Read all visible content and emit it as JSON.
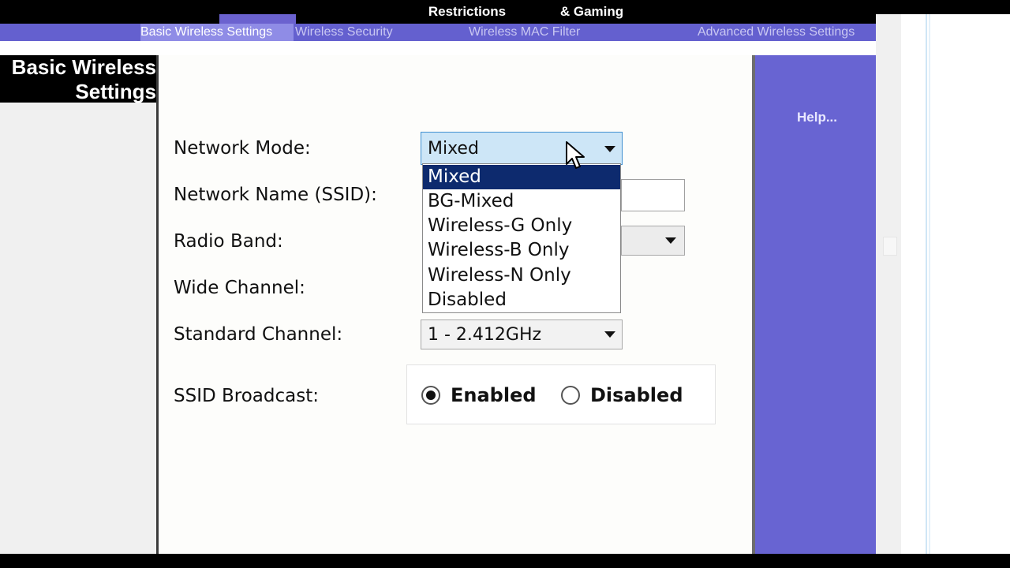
{
  "header": {
    "top_tabs": [
      "Restrictions",
      "& Gaming"
    ],
    "sub_tabs": [
      "Basic Wireless Settings",
      "Wireless Security",
      "Wireless MAC Filter",
      "Advanced Wireless Settings"
    ]
  },
  "section": {
    "title_line1": "Basic Wireless",
    "title_line2": "Settings"
  },
  "help": {
    "label": "Help..."
  },
  "form": {
    "network_mode_label": "Network Mode:",
    "network_mode_value": "Mixed",
    "network_mode_options": [
      "Mixed",
      "BG-Mixed",
      "Wireless-G Only",
      "Wireless-B Only",
      "Wireless-N Only",
      "Disabled"
    ],
    "ssid_label": "Network Name (SSID):",
    "radio_band_label": "Radio Band:",
    "wide_channel_label": "Wide Channel:",
    "standard_channel_label": "Standard Channel:",
    "standard_channel_value": "1 - 2.412GHz",
    "ssid_broadcast_label": "SSID Broadcast:",
    "broadcast_enabled": "Enabled",
    "broadcast_disabled": "Disabled",
    "broadcast_selected": "Enabled"
  },
  "colors": {
    "nav_purple": "#6460cf",
    "help_purple": "#6864d2",
    "selected_option": "#0d2a6e"
  }
}
